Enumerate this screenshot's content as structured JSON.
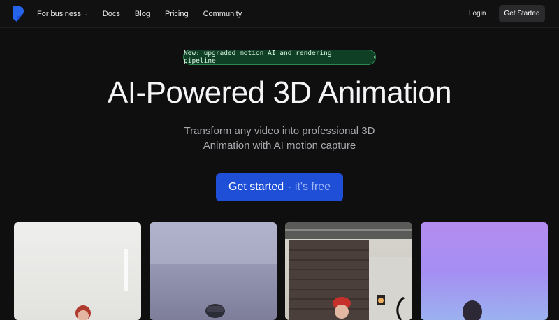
{
  "nav": {
    "links": [
      {
        "label": "For business",
        "has_dropdown": true
      },
      {
        "label": "Docs"
      },
      {
        "label": "Blog"
      },
      {
        "label": "Pricing"
      },
      {
        "label": "Community"
      }
    ],
    "login_label": "Login",
    "cta_label": "Get Started",
    "brand_color": "#2563eb"
  },
  "announcement": {
    "text": "New: upgraded motion AI and rendering pipeline",
    "arrow": "→"
  },
  "hero": {
    "title": "AI-Powered 3D Animation",
    "subtitle_line1": "Transform any video into professional 3D",
    "subtitle_line2": "Animation with AI motion capture",
    "cta_main": "Get started",
    "cta_secondary": "- it's free",
    "cta_color": "#1f4fd6"
  },
  "gallery": {
    "cards": [
      {
        "name": "demo-video-1"
      },
      {
        "name": "demo-video-2"
      },
      {
        "name": "demo-video-3"
      },
      {
        "name": "demo-video-4"
      }
    ]
  }
}
